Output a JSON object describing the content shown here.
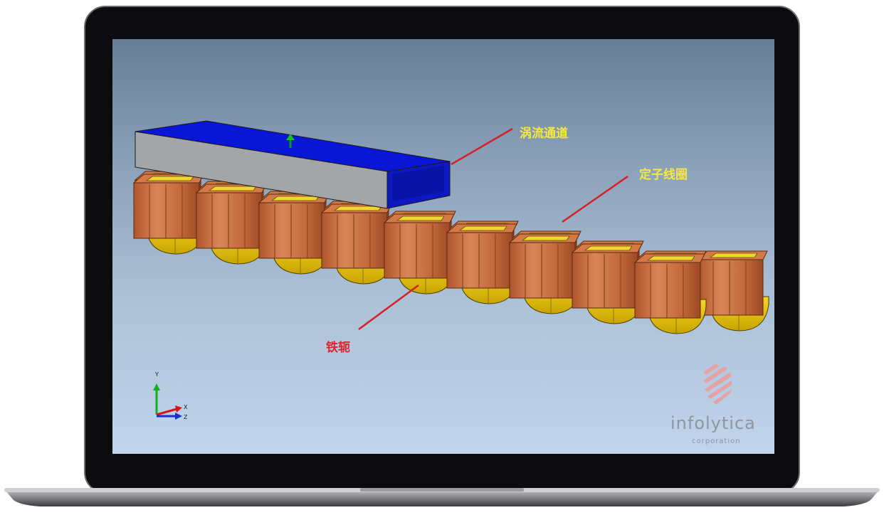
{
  "labels": {
    "eddy_channel": "涡流通道",
    "stator_coil": "定子线圈",
    "iron_yoke": "铁轭"
  },
  "axis": {
    "y": "Y",
    "x": "X",
    "z": "Z"
  },
  "logo": {
    "name": "infolytica",
    "subtitle": "corporation"
  },
  "colors": {
    "label_yellow": "#f6e93a",
    "label_red": "#e2222a",
    "leader_line": "#d42028",
    "channel_top": "#0a16d6",
    "channel_side": "#a3a5a6",
    "coil": "#c46a3c",
    "coil_inner": "#f0d430",
    "yoke": "#d9b800"
  },
  "icons": [
    "infolytica-logo-icon",
    "axis-triad-icon"
  ]
}
